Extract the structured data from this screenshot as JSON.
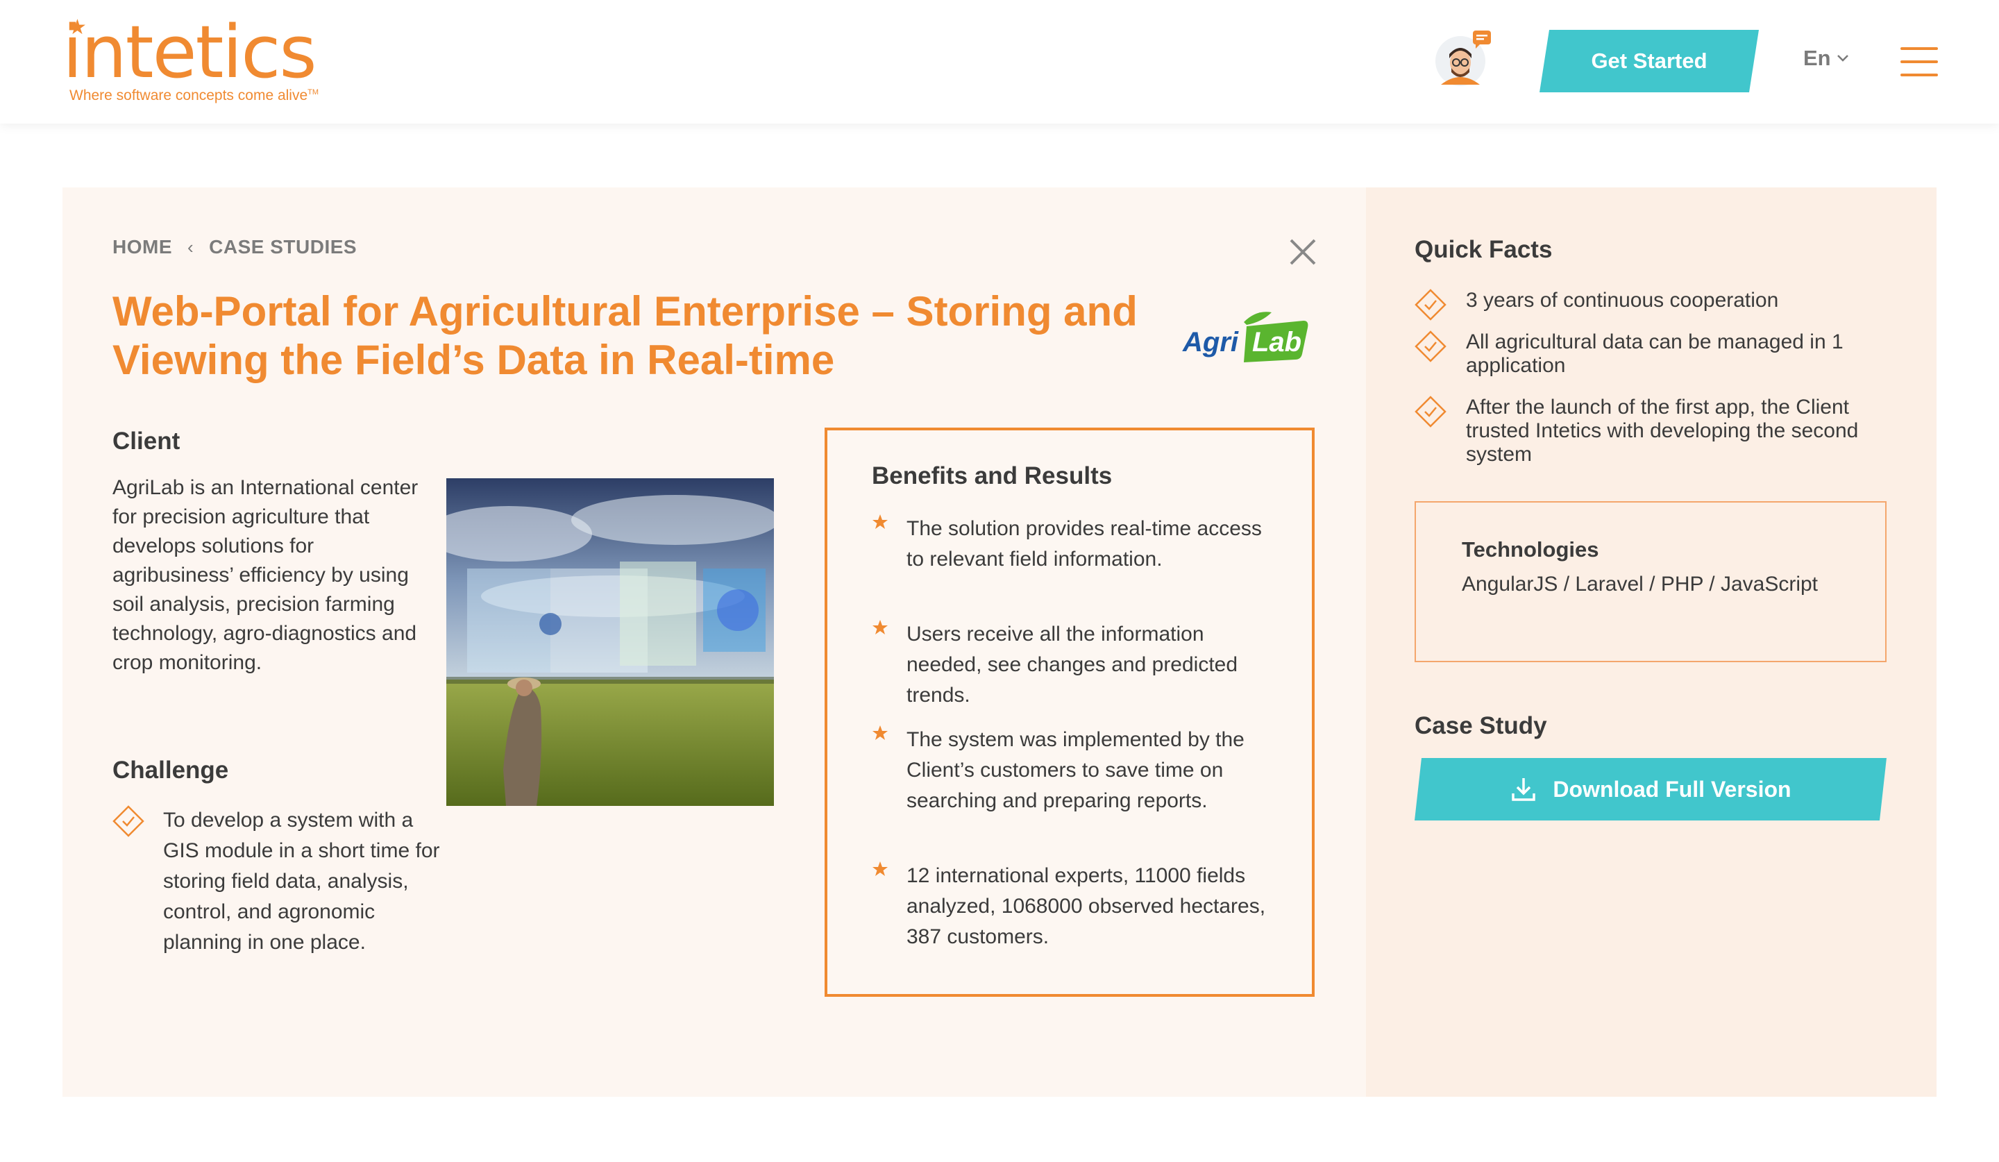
{
  "brand": {
    "name": "intetics",
    "tagline": "Where software concepts come alive",
    "trademark": "TM",
    "accent": "#f08a31",
    "cta_color": "#41c6cc"
  },
  "header": {
    "get_started_label": "Get Started",
    "language": "En",
    "avatar_icon": "support-avatar-icon",
    "menu_icon": "hamburger-menu-icon"
  },
  "breadcrumb": {
    "home": "HOME",
    "separator": "‹",
    "current": "CASE STUDIES"
  },
  "page": {
    "title": "Web-Portal for Agricultural Enterprise – Storing and Viewing the Field’s Data in Real-time",
    "client_logo_text_1": "Agri",
    "client_logo_text_2": "Lab"
  },
  "client": {
    "heading": "Client",
    "text": "AgriLab is an International center for precision agriculture that develops solutions for agribusiness’ efficiency by using soil analysis, precision farming technology, agro-diagnostics and crop monitoring."
  },
  "challenge": {
    "heading": "Challenge",
    "items": [
      "To develop a system with a GIS module in a short time for storing field data, analysis, control, and agronomic planning in one place."
    ]
  },
  "benefits": {
    "heading": "Benefits and Results",
    "items": [
      "The solution provides real-time access to relevant field information.",
      "Users receive all the information needed, see changes and predicted trends.",
      "The system was implemented by the Client’s customers to save time on searching and preparing reports.",
      "12 international experts, 11000 fields analyzed, 1068000 observed hectares, 387 customers."
    ]
  },
  "quick_facts": {
    "heading": "Quick Facts",
    "items": [
      "3 years of continuous cooperation",
      "All agricultural data can be managed in 1 application",
      "After the launch of the first app, the Client trusted Intetics with developing the second system"
    ]
  },
  "technologies": {
    "heading": "Technologies",
    "value": "AngularJS / Laravel / PHP / JavaScript"
  },
  "case_study": {
    "heading": "Case Study",
    "download_label": "Download Full Version",
    "download_icon": "download-icon"
  }
}
